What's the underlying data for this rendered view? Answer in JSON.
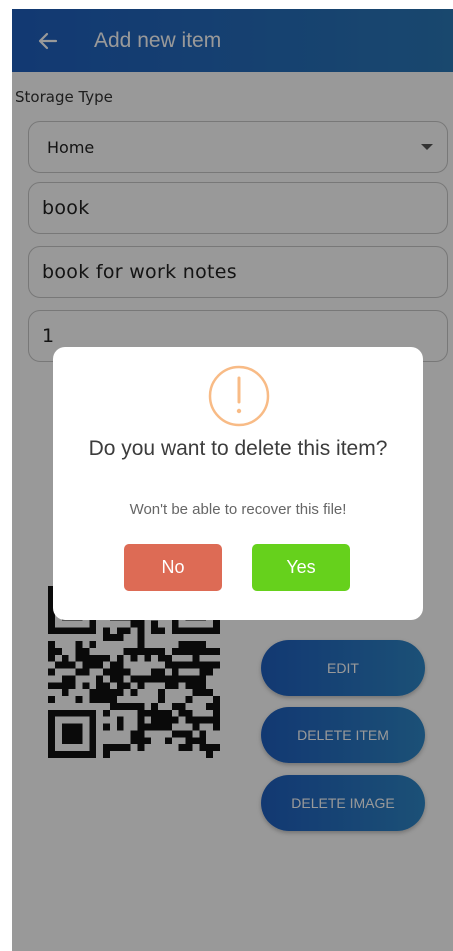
{
  "appbar": {
    "title": "Add new item",
    "back_icon": "arrow-left-icon",
    "gradient": [
      "#1f5fbf",
      "#2a78b8"
    ]
  },
  "form": {
    "storage_type_label": "Storage Type",
    "storage_type_value": "Home",
    "name_value": "book",
    "description_value": "book for work notes",
    "quantity_value": "1"
  },
  "actions": {
    "edit_label": "EDIT",
    "delete_item_label": "DELETE ITEM",
    "delete_image_label": "DELETE IMAGE"
  },
  "qr_code": {
    "icon": "qr-code-image"
  },
  "dialog": {
    "icon": "warning-circle-icon",
    "icon_color": "#f8bb86",
    "title": "Do you want to delete this item?",
    "message": "Won't be able to recover this file!",
    "no_label": "No",
    "yes_label": "Yes",
    "no_color": "#dd6b55",
    "yes_color": "#66d11c"
  }
}
